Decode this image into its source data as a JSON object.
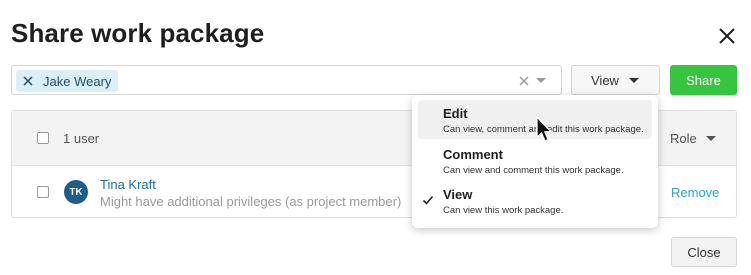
{
  "dialog": {
    "title": "Share work package"
  },
  "principal_select": {
    "chip_label": "Jake Weary"
  },
  "view_button": {
    "label": "View"
  },
  "share_button": {
    "label": "Share",
    "color": "#35c53f"
  },
  "table": {
    "header_count": "1 user",
    "role_header": "Role",
    "rows": [
      {
        "initials": "TK",
        "name": "Tina Kraft",
        "subtitle": "Might have additional privileges (as project member)",
        "action": "Remove"
      }
    ]
  },
  "dropdown": {
    "options": [
      {
        "title": "Edit",
        "description": "Can view, comment and edit this work package.",
        "hovered": true,
        "selected": false
      },
      {
        "title": "Comment",
        "description": "Can view and comment this work package.",
        "hovered": false,
        "selected": false
      },
      {
        "title": "View",
        "description": "Can view this work package.",
        "hovered": false,
        "selected": true
      }
    ]
  },
  "footer": {
    "close_label": "Close"
  },
  "icons": {
    "close": "close-icon",
    "chip_remove": "x-icon",
    "clear": "clear-icon",
    "check": "check-icon",
    "cursor": "mouse-pointer-icon"
  }
}
